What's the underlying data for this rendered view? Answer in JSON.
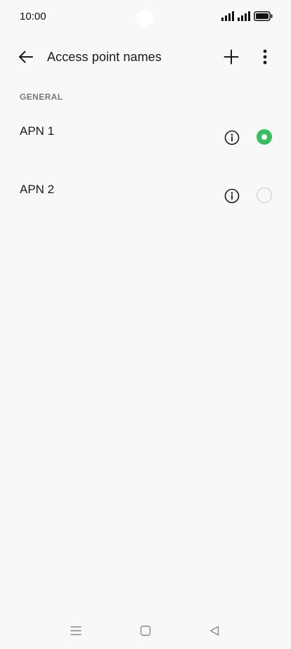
{
  "status_bar": {
    "time": "10:00"
  },
  "app_bar": {
    "title": "Access point names",
    "back_icon": "arrow-left-icon",
    "add_icon": "plus-icon",
    "more_icon": "more-vertical-icon"
  },
  "section": {
    "header": "GENERAL"
  },
  "apns": [
    {
      "name": "APN 1",
      "selected": true
    },
    {
      "name": "APN 2",
      "selected": false
    }
  ],
  "colors": {
    "background": "#f8f8f8",
    "accent": "#35bf5f",
    "text_primary": "#1a1a1a",
    "text_secondary": "#7a7a7a"
  },
  "nav_bar": {
    "icons": [
      "menu-icon",
      "home-square-icon",
      "back-triangle-icon"
    ]
  }
}
